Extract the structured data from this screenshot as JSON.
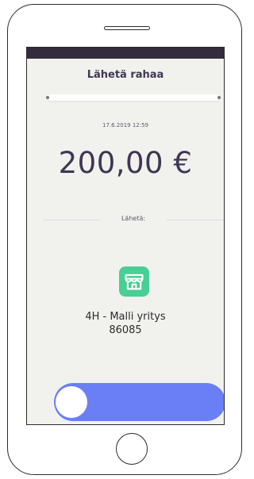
{
  "screen": {
    "title": "Lähetä rahaa",
    "timestamp": "17.6.2019 12:59",
    "amount": "200,00 €",
    "send_label": "Lähetä:"
  },
  "merchant": {
    "icon": "shop-icon",
    "name": "4H - Malli yritys",
    "id": "86085"
  },
  "slider": {
    "value": 0,
    "knob_position": "left"
  },
  "colors": {
    "status_bar": "#332c3e",
    "title_text": "#3e3753",
    "screen_background": "#f1f1ee",
    "shop_icon_background": "#48cf94",
    "slider_track": "#6a7ff6",
    "slider_knob": "#ffffff"
  }
}
